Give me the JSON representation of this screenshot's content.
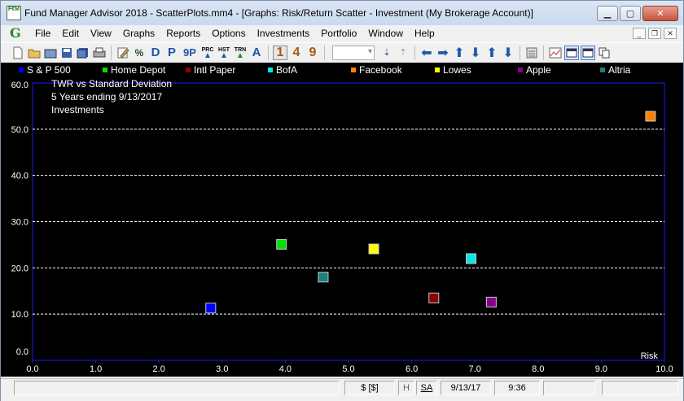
{
  "window": {
    "title": "Fund Manager Advisor 2018 - ScatterPlots.mm4 - [Graphs: Risk/Return Scatter - Investment (My Brokerage Account)]",
    "app_icon_text": "F€M",
    "minimize": "▁",
    "maximize": "▢",
    "close": "✕"
  },
  "menubar": {
    "logo": "G",
    "items": [
      {
        "label": "File"
      },
      {
        "label": "Edit"
      },
      {
        "label": "View"
      },
      {
        "label": "Graphs"
      },
      {
        "label": "Reports"
      },
      {
        "label": "Options"
      },
      {
        "label": "Investments"
      },
      {
        "label": "Portfolio"
      },
      {
        "label": "Window"
      },
      {
        "label": "Help"
      }
    ],
    "mdi_min": "_",
    "mdi_restore": "❐",
    "mdi_close": "✕"
  },
  "toolbar": {
    "d": "D",
    "p": "P",
    "nine_p": "9P",
    "prc": "PRC",
    "hst": "HST",
    "trn": "TRN",
    "a": "A",
    "one": "1",
    "four": "4",
    "nine": "9",
    "percent": "%"
  },
  "chart_data": {
    "type": "scatter",
    "title_lines": [
      "TWR vs Standard Deviation",
      "5 Years ending 9/13/2017",
      "Investments"
    ],
    "xlabel": "Risk",
    "xlim": [
      0,
      10
    ],
    "ylim": [
      0,
      60
    ],
    "x_ticks": [
      "0.0",
      "1.0",
      "2.0",
      "3.0",
      "4.0",
      "5.0",
      "6.0",
      "7.0",
      "8.0",
      "9.0",
      "10.0"
    ],
    "y_ticks": [
      "0.0",
      "10.0",
      "20.0",
      "30.0",
      "40.0",
      "50.0",
      "60.0"
    ],
    "grid": "horizontal dashed",
    "series": [
      {
        "name": "S & P 500",
        "color": "#0000ff",
        "x": 2.82,
        "y": 11.3
      },
      {
        "name": "Home Depot",
        "color": "#00e000",
        "x": 3.94,
        "y": 25.1
      },
      {
        "name": "Intl Paper",
        "color": "#8b0000",
        "x": 6.35,
        "y": 13.5
      },
      {
        "name": "BofA",
        "color": "#00e8e8",
        "x": 6.94,
        "y": 22.0
      },
      {
        "name": "Facebook",
        "color": "#ff8000",
        "x": 9.78,
        "y": 52.8
      },
      {
        "name": "Lowes",
        "color": "#ffff00",
        "x": 5.4,
        "y": 24.1
      },
      {
        "name": "Apple",
        "color": "#8b008b",
        "x": 7.26,
        "y": 12.6
      },
      {
        "name": "Altria",
        "color": "#1a8080",
        "x": 4.6,
        "y": 18.0
      }
    ]
  },
  "statusbar": {
    "currency": "$ [$]",
    "h": "H",
    "sa": "SA",
    "date": "9/13/17",
    "time": "9:36"
  }
}
